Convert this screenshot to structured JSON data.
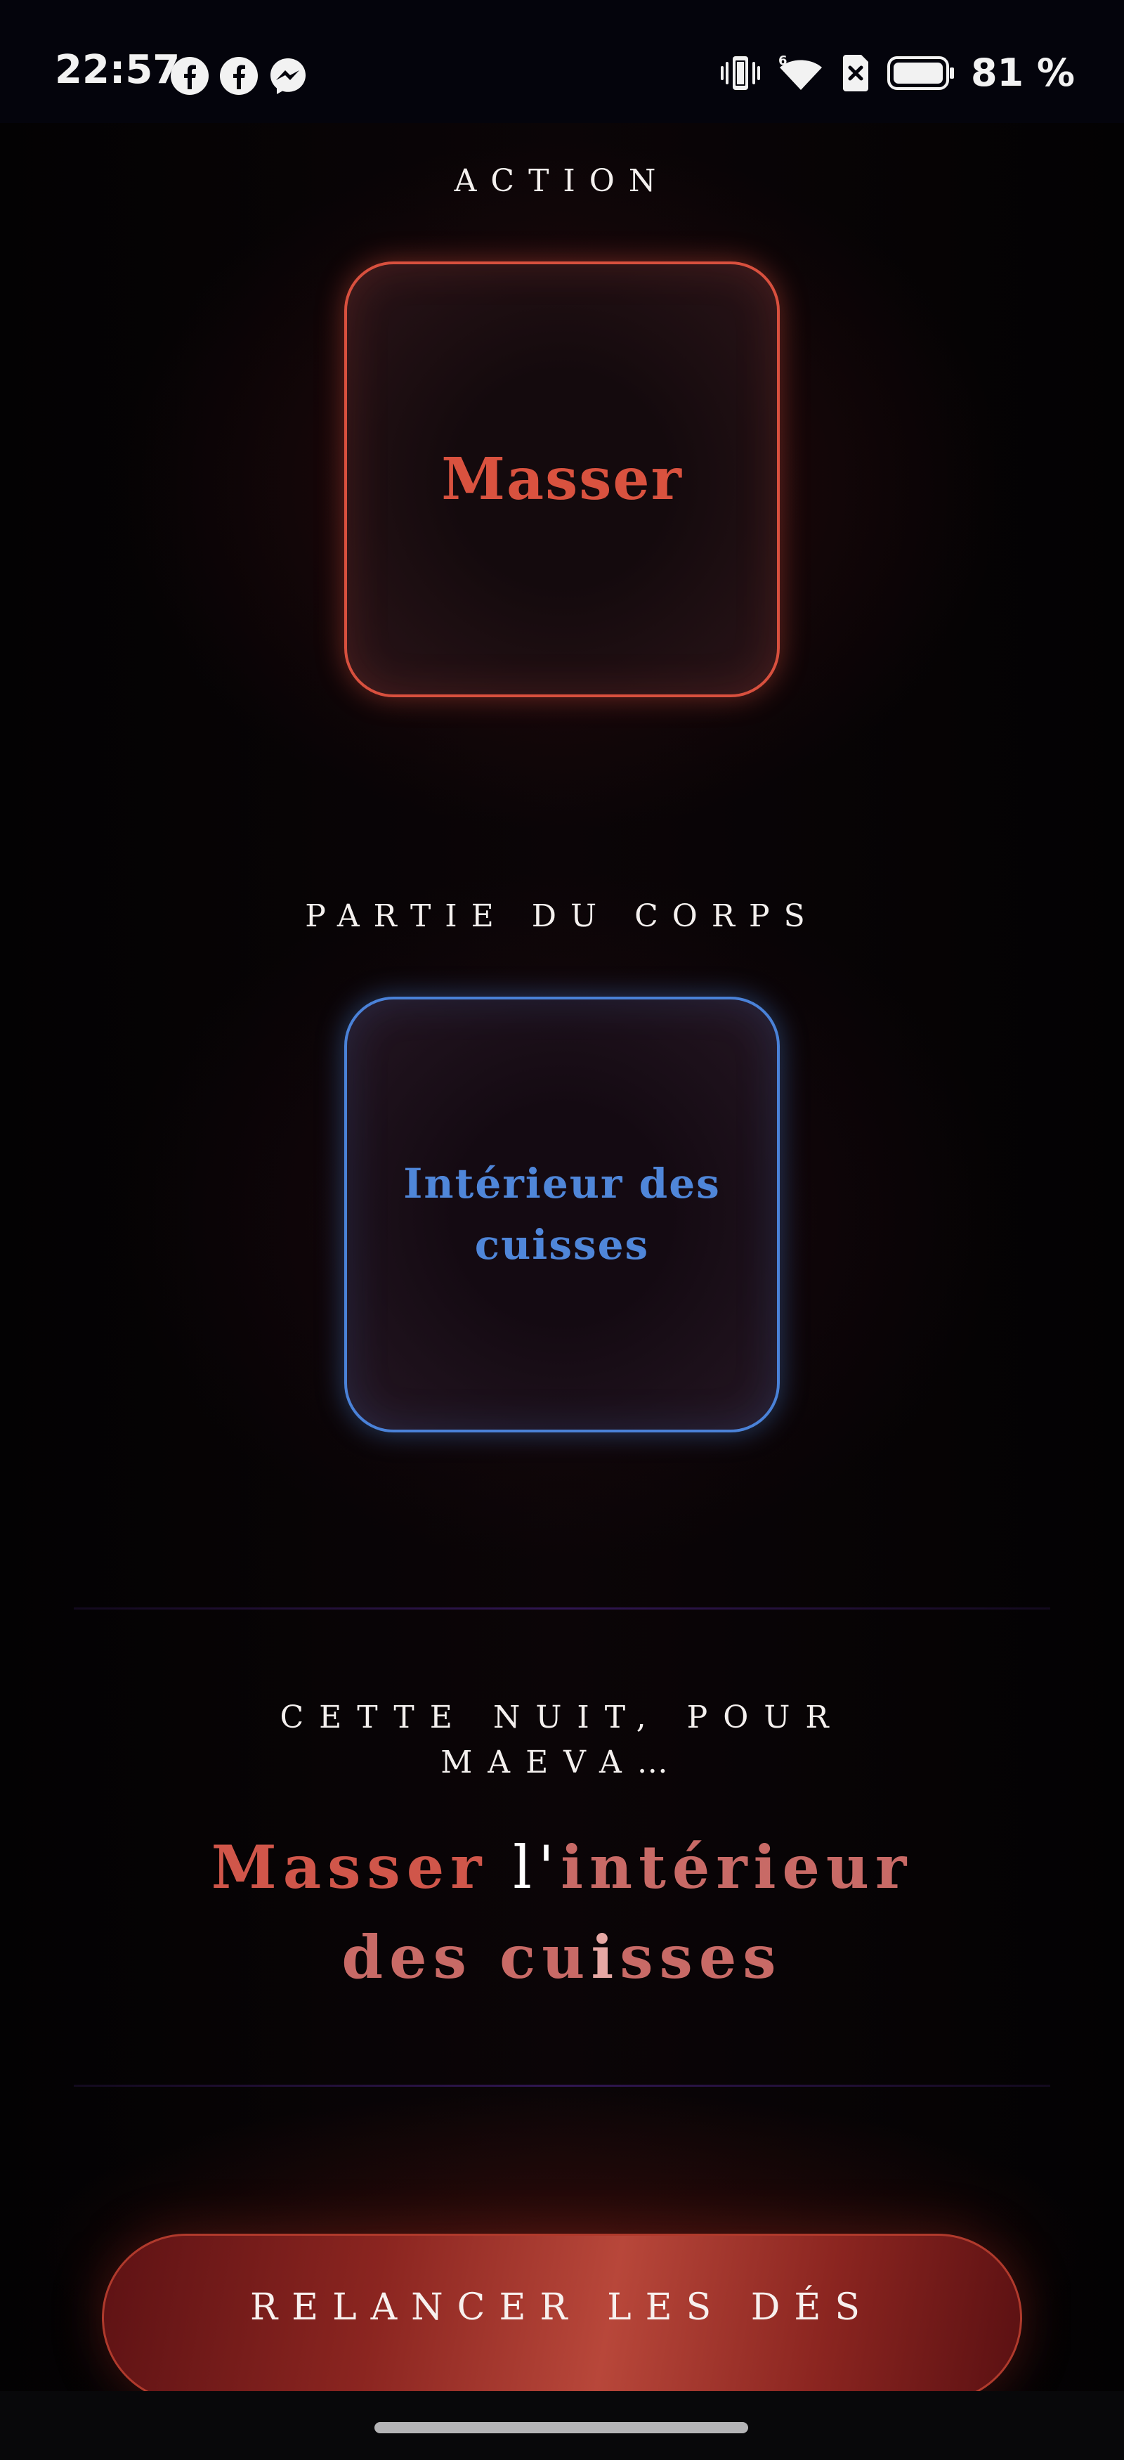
{
  "status_bar": {
    "time": "22:57",
    "notifications": [
      "facebook-icon",
      "facebook-icon",
      "messenger-icon"
    ],
    "system_icons": [
      "vibrate-icon",
      "wifi-icon",
      "no-sim-icon",
      "battery-icon"
    ],
    "battery_percent": "81 %"
  },
  "action": {
    "label": "ACTION",
    "value": "Masser",
    "color": "#d9523f"
  },
  "body_part": {
    "label": "PARTIE DU CORPS",
    "value": "Intérieur des cuisses",
    "color": "#4f86d9"
  },
  "result": {
    "label_line1": "CETTE NUIT, POUR",
    "label_line2": "MAEVA…",
    "line1": {
      "part1": "Masser",
      "part2": " l'",
      "part3": "intérieur"
    },
    "line2": {
      "part1": "des cu",
      "part2": "i",
      "part3": "sses"
    }
  },
  "button": {
    "label": "RELANCER LES DÉS"
  }
}
